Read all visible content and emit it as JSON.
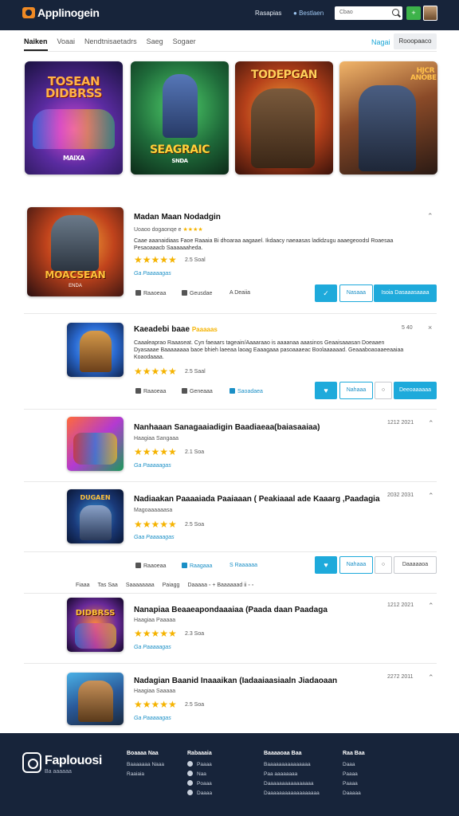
{
  "header": {
    "brand": "Applinogein",
    "links": [
      "Rasapias",
      "Bestlaen"
    ],
    "search_placeholder": "Cbao",
    "badge": "+"
  },
  "tabs": {
    "items": [
      "Naiken",
      "Voaai",
      "Nendtnisaetadrs",
      "Saeg",
      "Sogaer"
    ],
    "right_link": "Nagai",
    "right_button": "Rooopaaco"
  },
  "featured": [
    {
      "title": "TOSEAN DIDBRSS",
      "sub": "MAIXA"
    },
    {
      "title": "SEAGRAIC",
      "sub": "SNDA"
    },
    {
      "title": "TODEPGAN",
      "sub": ""
    },
    {
      "title": "HJCR ANOBE",
      "sub": ""
    }
  ],
  "games": [
    {
      "title": "Madan Maan Nodadgin",
      "sub": "Uoaoo dogaonqe e",
      "desc": "Caae aaanaidiaas Faoe Raaaia Bi dhoaraa aagaael. Ikdaacy naeaasas  ladidzugu aaaegeoodsl Roaesaa Pesaoaaacb Saaaaaaheda.",
      "rating": "2.5 Soal",
      "link": "Ga Paaaaagas",
      "meta": [
        "Raaoeaa",
        "Geusdae",
        "A Deaiia"
      ],
      "buttons": [
        "Nasaaa",
        "Isoia Dasaaasaaaa"
      ],
      "thumb_title": "MOACSEAN",
      "thumb_sub": "ENDA"
    },
    {
      "title": "Kaeadebi baae",
      "badge": "Paaaaas",
      "date": "5 40",
      "desc": "Caaaleaprao Raaaseat. Cyn faeaars tageain/Aaaaraao is aaaanaa aaasinos Geaaisaaasan Doeaaen Dyasaaae Baaaaaaaa baoe bhieh laeeaa laoag Eaaagaaa pasoaaaeac Boolaaaaaad. Geaaaboaoaaeeaaiaa Koaodaaaa.",
      "rating": "2.5 Saal",
      "meta": [
        "Raaoeaa",
        "Geneaaa",
        "Saoadaea"
      ],
      "buttons": [
        "Nahaaa",
        "Deeoaaaaaa"
      ]
    },
    {
      "title": "Nanhaaan Sanagaaiadigin Baadiaeaa(baiasaaiaa)",
      "sub": "Haagiaa Sangaaa",
      "date": "1212 2021",
      "rating": "2.1 Soa",
      "link": "Ga Paaaaagas"
    },
    {
      "title": "Nadiaakan Paaaaiada Paaiaaan ( Peakiaaal ade Kaaarg ,Paadagia",
      "sub": "Magoaaaaaasa",
      "date": "2032 2031",
      "rating": "2.5 Soa",
      "link": "Gaa Paaaaagas",
      "meta": [
        "Raaoeaa",
        "Raagaaa",
        "S Raaaaaa"
      ],
      "buttons": [
        "Nahaaa",
        "Daaaaaoa"
      ]
    },
    {
      "title": "Nanapiaa Beaaeapondaaaiaa (Paada daan Paadaga",
      "sub": "Haagiaa Paaaaa",
      "date": "1212 2021",
      "rating": "2.3 Soa",
      "link": "Ga Paaaaagas"
    },
    {
      "title": "Nadagian Baanid Inaaaikan (Iadaaiaasiaaln Jiadaoaan",
      "sub": "Haagiaa Saaaaa",
      "date": "2272 2011",
      "rating": "2.5 Soa",
      "link": "Ga Paaaaagas"
    }
  ],
  "filter_bar": [
    "Fiaaa",
    "Tas Saa",
    "Saaaaaaaa",
    "Paiagg",
    "Daaaaa ◦ + Baaaaaad ii ◦ ◦"
  ],
  "footer": {
    "brand": "Faplouosi",
    "tagline": "Ba aaaaaa",
    "cols": [
      {
        "title": "Boaaaa Naa",
        "items": [
          "Baaaaaaa Naaa",
          "Raaiaia"
        ]
      },
      {
        "title": "Rabaaaia",
        "items": [
          "Paaaa",
          "Naa",
          "Poaaa",
          "Daaaa"
        ]
      },
      {
        "title": "Baaaaoaa Baa",
        "items": [
          "Baaaaaaaaaaaaaaa",
          "Paa aaaaaaaa",
          "Daaaaaaaaaaaaaaaa",
          "Daaaaaaaaaaaaaaaaaa"
        ]
      },
      {
        "title": "Raa Baa",
        "items": [
          "Daaa",
          "Paaaa",
          "Paaaa",
          "Daaaaa"
        ]
      }
    ]
  },
  "colors": {
    "navy": "#17243a",
    "accent": "#1eaadb",
    "star": "#f5b301",
    "logo": "#f08a24"
  }
}
